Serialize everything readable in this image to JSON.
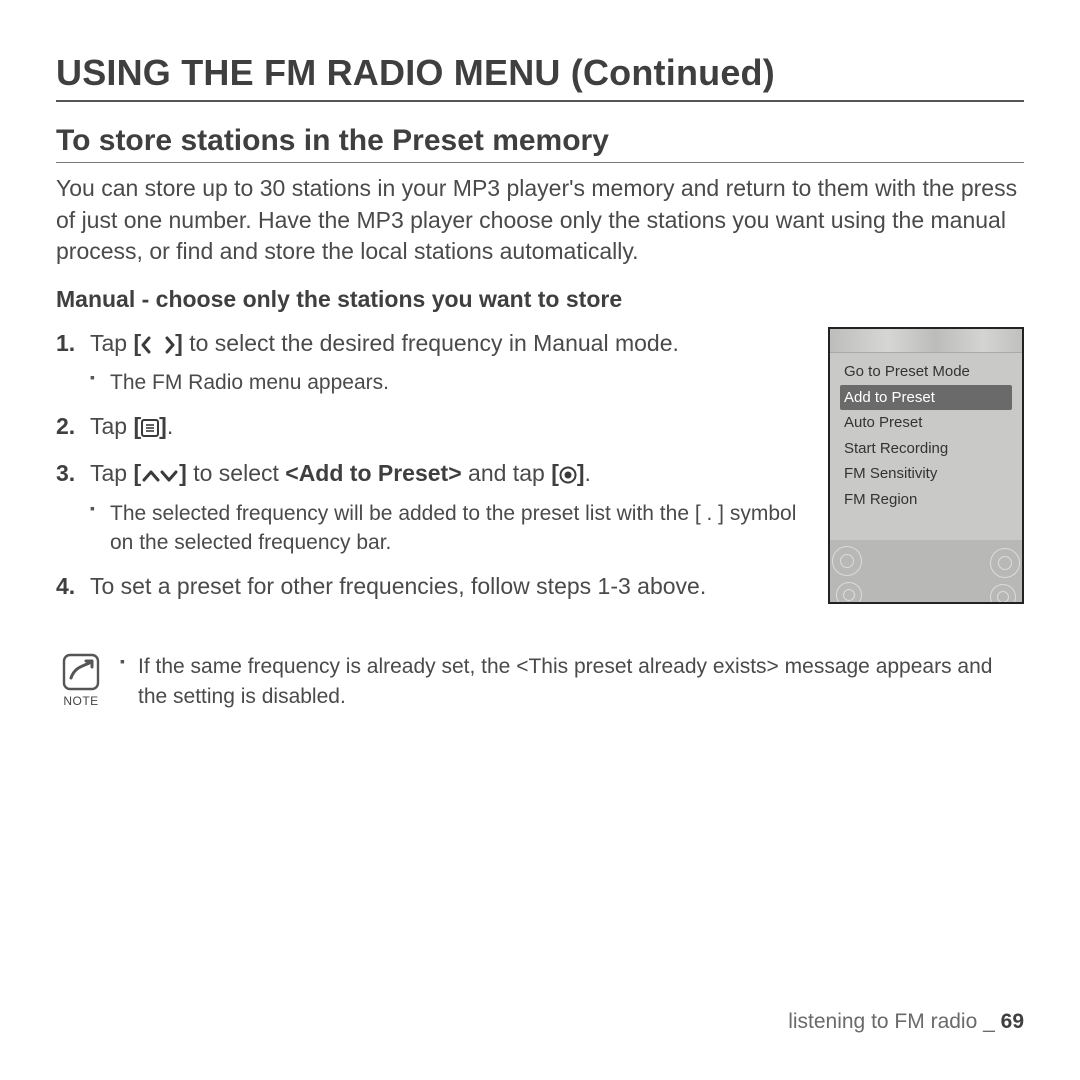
{
  "h1": "USING THE FM RADIO MENU (Continued)",
  "h2": "To store stations in the Preset memory",
  "intro": "You can store up to 30 stations in your MP3 player's memory and return to them with the press of just one number. Have the MP3 player choose only the stations you want using the manual process, or find and store the local stations automatically.",
  "h3": "Manual - choose only the stations you want to store",
  "steps": {
    "s1a": "Tap ",
    "s1b": " to select the desired frequency in Manual mode.",
    "s1sub": "The FM Radio menu appears.",
    "s2a": "Tap ",
    "s2b": ".",
    "s3a": "Tap ",
    "s3b": " to select ",
    "s3bold": "<Add to Preset>",
    "s3c": " and tap ",
    "s3d": ".",
    "s3sub": "The selected frequency will be added to the preset list with the [ . ] symbol on the selected frequency bar.",
    "s4": "To set a preset for other frequencies, follow steps 1-3 above."
  },
  "device_menu": [
    "Go to Preset Mode",
    "Add to Preset",
    "Auto Preset",
    "Start Recording",
    "FM Sensitivity",
    "FM Region"
  ],
  "device_selected_index": 1,
  "note": {
    "label": "NOTE",
    "text": "If the same frequency is already set, the <This preset already exists> message appears and the setting is disabled."
  },
  "footer": {
    "section": "listening to FM radio _",
    "page": "69"
  }
}
